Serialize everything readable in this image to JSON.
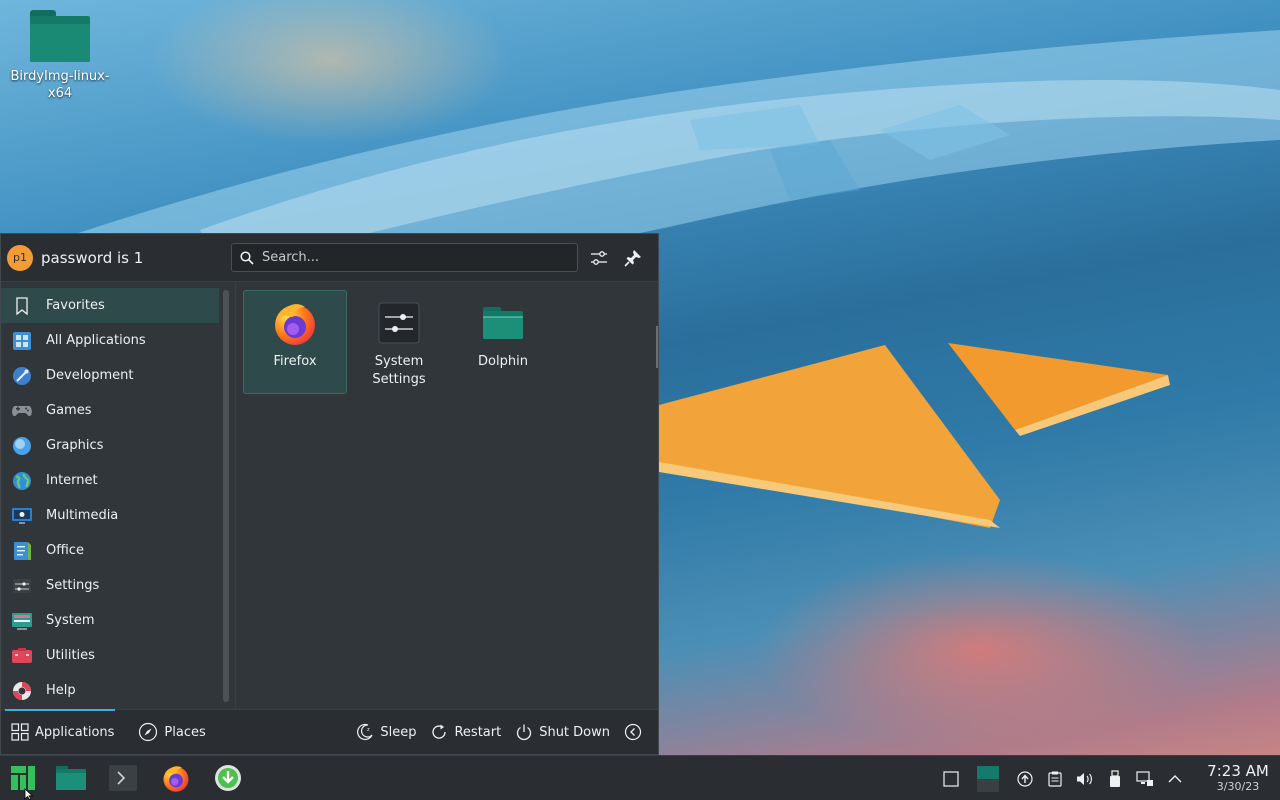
{
  "desktop": {
    "icons": [
      {
        "label": "BirdyImg-linux-x64"
      }
    ]
  },
  "launcher": {
    "user": {
      "avatar_initials": "p1",
      "name": "password is 1"
    },
    "search": {
      "placeholder": "Search..."
    },
    "categories": [
      {
        "label": "Favorites",
        "icon": "bookmark-icon",
        "active": true
      },
      {
        "label": "All Applications",
        "icon": "grid-icon"
      },
      {
        "label": "Development",
        "icon": "development-icon"
      },
      {
        "label": "Games",
        "icon": "gamepad-icon"
      },
      {
        "label": "Graphics",
        "icon": "graphics-icon"
      },
      {
        "label": "Internet",
        "icon": "globe-icon"
      },
      {
        "label": "Multimedia",
        "icon": "multimedia-icon"
      },
      {
        "label": "Office",
        "icon": "office-icon"
      },
      {
        "label": "Settings",
        "icon": "settings-icon"
      },
      {
        "label": "System",
        "icon": "system-icon"
      },
      {
        "label": "Utilities",
        "icon": "utilities-icon"
      },
      {
        "label": "Help",
        "icon": "help-icon"
      }
    ],
    "favorites": [
      {
        "label": "Firefox",
        "icon": "firefox-icon"
      },
      {
        "label": "System Settings",
        "icon": "system-settings-icon"
      },
      {
        "label": "Dolphin",
        "icon": "folder-icon"
      }
    ],
    "footer": {
      "applications": "Applications",
      "places": "Places",
      "sleep": "Sleep",
      "restart": "Restart",
      "shutdown": "Shut Down"
    }
  },
  "taskbar": {
    "clock": {
      "time": "7:23 AM",
      "date": "3/30/23"
    }
  },
  "colors": {
    "accent": "#3daee9",
    "panel": "#31363b",
    "highlight": "#2f4a4b"
  }
}
